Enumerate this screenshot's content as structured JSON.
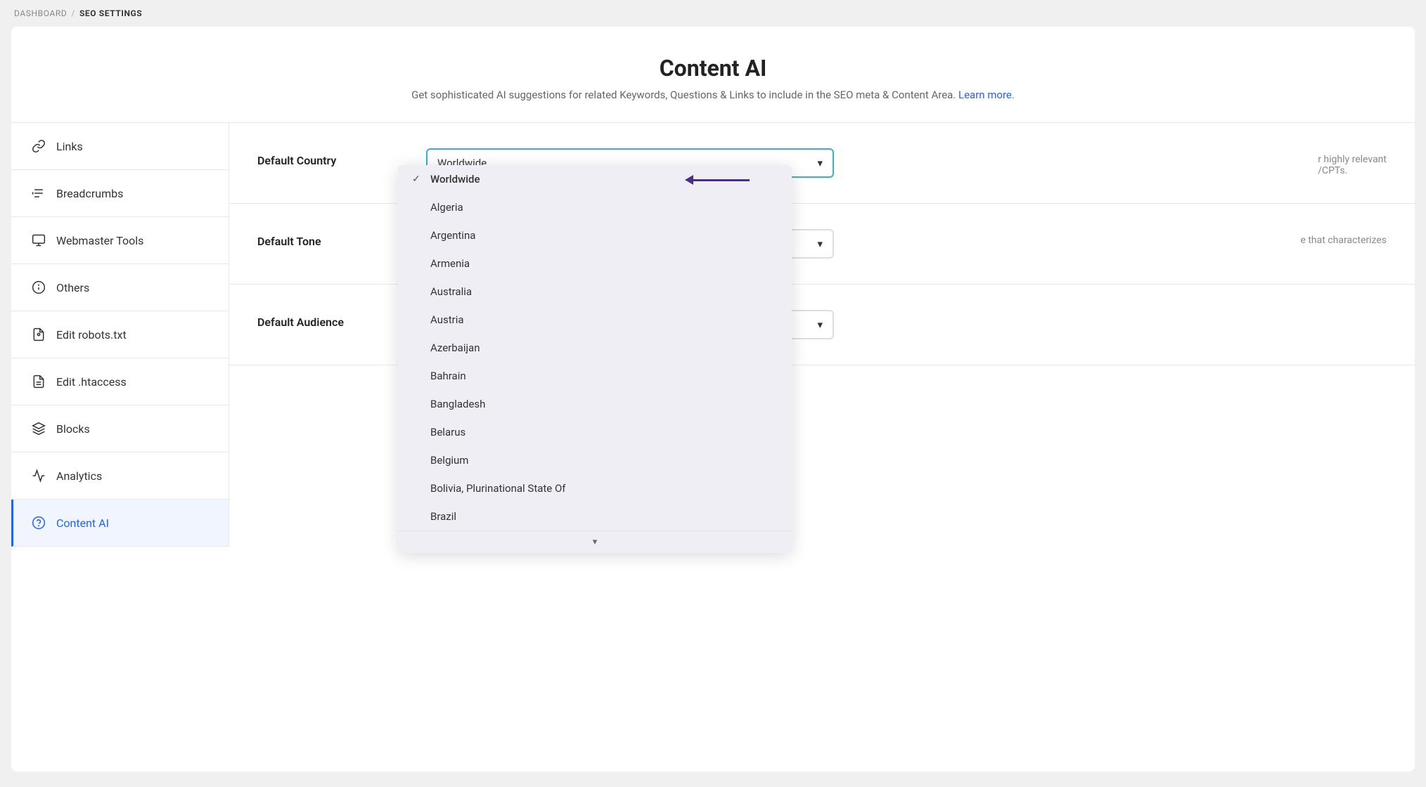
{
  "breadcrumb": {
    "dashboard": "DASHBOARD",
    "separator": "/",
    "current": "SEO SETTINGS"
  },
  "header": {
    "title": "Content AI",
    "description": "Get sophisticated AI suggestions for related Keywords, Questions & Links to include in the SEO meta & Content Area.",
    "learn_more": "Learn more"
  },
  "sidebar": {
    "items": [
      {
        "id": "links",
        "label": "Links",
        "icon": "links-icon",
        "active": false
      },
      {
        "id": "breadcrumbs",
        "label": "Breadcrumbs",
        "icon": "breadcrumbs-icon",
        "active": false
      },
      {
        "id": "webmaster-tools",
        "label": "Webmaster Tools",
        "icon": "webmaster-icon",
        "active": false
      },
      {
        "id": "others",
        "label": "Others",
        "icon": "others-icon",
        "active": false
      },
      {
        "id": "edit-robots",
        "label": "Edit robots.txt",
        "icon": "robots-icon",
        "active": false
      },
      {
        "id": "edit-htaccess",
        "label": "Edit .htaccess",
        "icon": "htaccess-icon",
        "active": false
      },
      {
        "id": "blocks",
        "label": "Blocks",
        "icon": "blocks-icon",
        "active": false
      },
      {
        "id": "analytics",
        "label": "Analytics",
        "icon": "analytics-icon",
        "active": false
      },
      {
        "id": "content-ai",
        "label": "Content AI",
        "icon": "content-ai-icon",
        "active": true
      }
    ]
  },
  "settings": [
    {
      "id": "default-country",
      "label": "Default Country",
      "right_text": "r highly relevant\n/CPTs."
    },
    {
      "id": "default-tone",
      "label": "Default Tone",
      "right_text": "e that characterizes"
    },
    {
      "id": "default-audience",
      "label": "Default Audience",
      "right_text": ""
    }
  ],
  "dropdown": {
    "selected": "Worldwide",
    "items": [
      {
        "id": "worldwide",
        "label": "Worldwide",
        "checked": true
      },
      {
        "id": "algeria",
        "label": "Algeria",
        "checked": false
      },
      {
        "id": "argentina",
        "label": "Argentina",
        "checked": false
      },
      {
        "id": "armenia",
        "label": "Armenia",
        "checked": false
      },
      {
        "id": "australia",
        "label": "Australia",
        "checked": false
      },
      {
        "id": "austria",
        "label": "Austria",
        "checked": false
      },
      {
        "id": "azerbaijan",
        "label": "Azerbaijan",
        "checked": false
      },
      {
        "id": "bahrain",
        "label": "Bahrain",
        "checked": false
      },
      {
        "id": "bangladesh",
        "label": "Bangladesh",
        "checked": false
      },
      {
        "id": "belarus",
        "label": "Belarus",
        "checked": false
      },
      {
        "id": "belgium",
        "label": "Belgium",
        "checked": false
      },
      {
        "id": "bolivia",
        "label": "Bolivia, Plurinational State Of",
        "checked": false
      },
      {
        "id": "brazil",
        "label": "Brazil",
        "checked": false
      }
    ],
    "footer_icon": "chevron-down"
  },
  "colors": {
    "active_blue": "#2563eb",
    "dropdown_border": "#38b2ca",
    "dropdown_bg": "#f0eef5",
    "arrow_color": "#4a2d8a"
  }
}
